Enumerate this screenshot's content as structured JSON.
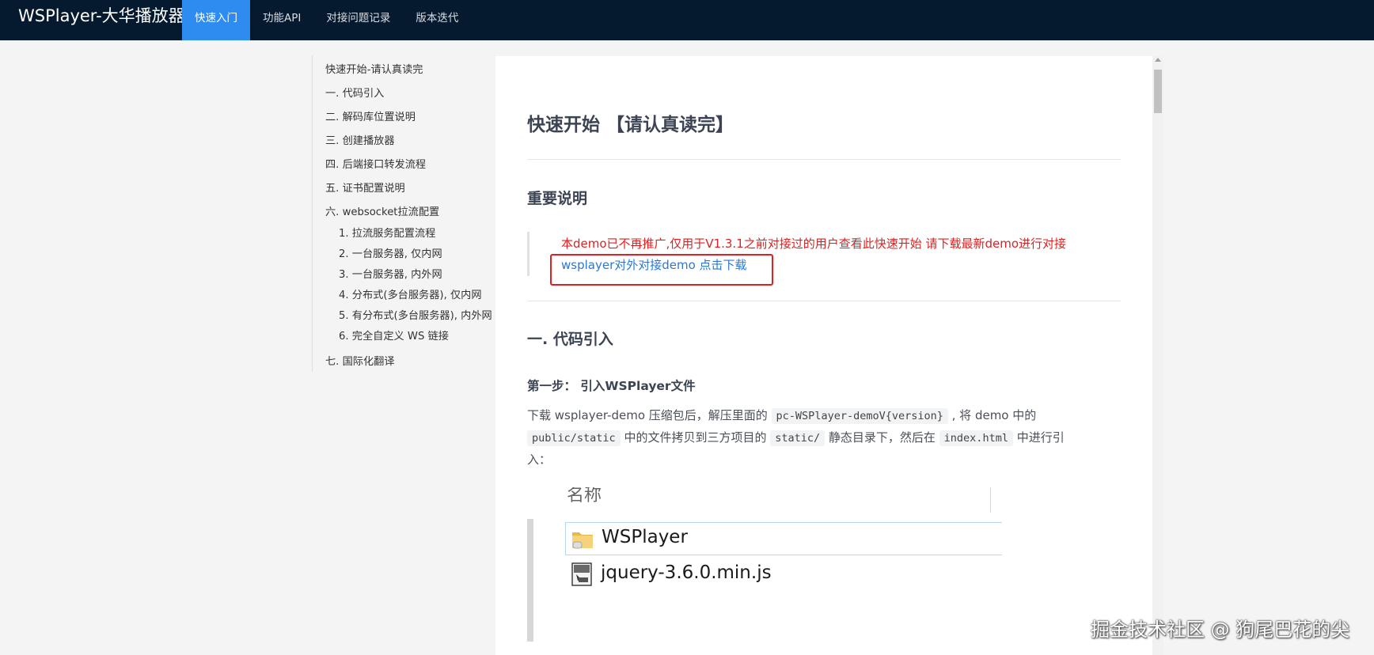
{
  "navbar": {
    "brand": "WSPlayer-大华播放器",
    "items": [
      {
        "label": "快速入门",
        "active": true
      },
      {
        "label": "功能API"
      },
      {
        "label": "对接问题记录"
      },
      {
        "label": "版本迭代"
      }
    ]
  },
  "toc": {
    "items": [
      {
        "label": "快速开始-请认真读完"
      },
      {
        "label": "一. 代码引入"
      },
      {
        "label": "二. 解码库位置说明"
      },
      {
        "label": "三. 创建播放器"
      },
      {
        "label": "四. 后端接口转发流程"
      },
      {
        "label": "五. 证书配置说明"
      },
      {
        "label": "六. websocket拉流配置"
      },
      {
        "label": "1. 拉流服务配置流程"
      },
      {
        "label": "2. 一台服务器, 仅内网"
      },
      {
        "label": "3. 一台服务器, 内外网"
      },
      {
        "label": "4. 分布式(多台服务器), 仅内网"
      },
      {
        "label": "5. 有分布式(多台服务器), 内外网"
      },
      {
        "label": "6. 完全自定义 WS 链接"
      },
      {
        "label": "七. 国际化翻译"
      }
    ]
  },
  "content": {
    "title": "快速开始 【请认真读完】",
    "important_heading": "重要说明",
    "notice": "本demo已不再推广,仅用于V1.3.1之前对接过的用户查看此快速开始 请下载最新demo进行对接",
    "demo_link": "wsplayer对外对接demo 点击下载",
    "section1_heading": "一. 代码引入",
    "step1": "第一步： 引入WSPlayer文件",
    "para_line1_a": "下载 wsplayer-demo 压缩包后，解压里面的 ",
    "para_code1": "pc-WSPlayer-demoV{version}",
    "para_line1_b": " , 将 demo 中的",
    "para_code2": "public/static",
    "para_line2_a": " 中的文件拷贝到三方项目的 ",
    "para_code3": "static/",
    "para_line2_b": " 静态目录下，然后在 ",
    "para_code4": "index.html",
    "para_line2_c": " 中进行引",
    "para_line3": "入：",
    "screenshot": {
      "header": "名称",
      "files": [
        "WSPlayer",
        "jquery-3.6.0.min.js"
      ]
    }
  },
  "watermark": "掘金技术社区 @ 狗尾巴花的尖",
  "colors": {
    "navbar": "#061a2f",
    "active_tab": "#2e8cf0",
    "notice_red": "#e02020",
    "link_blue": "#2a78d6"
  }
}
